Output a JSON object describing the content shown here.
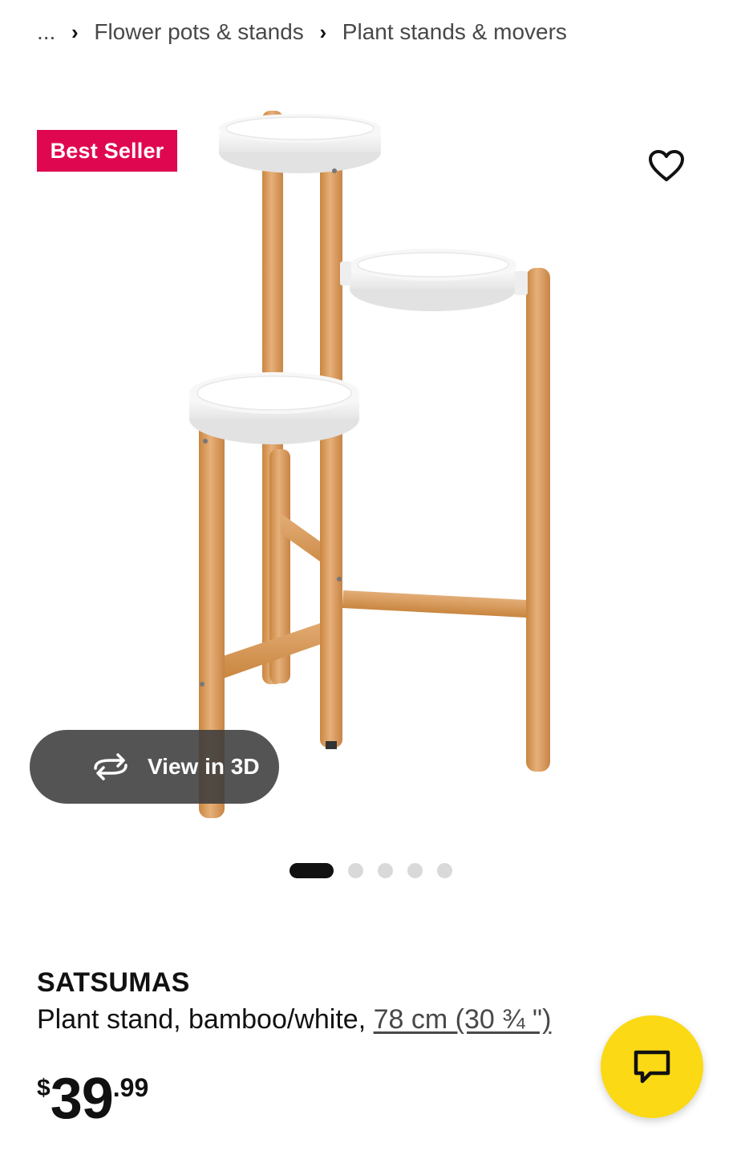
{
  "breadcrumb": {
    "ellipsis": "...",
    "items": [
      {
        "label": "Flower pots & stands"
      },
      {
        "label": "Plant stands & movers"
      }
    ],
    "separator": "›"
  },
  "badge": {
    "label": "Best Seller",
    "color": "#e00751"
  },
  "gallery": {
    "view_3d_label": "View in 3D",
    "total_images": 5,
    "active_index": 0
  },
  "product": {
    "name": "SATSUMAS",
    "description": "Plant stand, bamboo/white, ",
    "size_link": "78 cm (30 ¾ \")",
    "price": {
      "currency": "$",
      "integer": "39",
      "decimal": ".99"
    }
  },
  "colors": {
    "chat_button": "#fbd914",
    "bamboo": "#d99a5b",
    "tray": "#f4f4f4"
  },
  "icons": {
    "favorite": "heart-outline-icon",
    "view3d": "rotate-3d-icon",
    "chat": "chat-bubble-icon"
  }
}
